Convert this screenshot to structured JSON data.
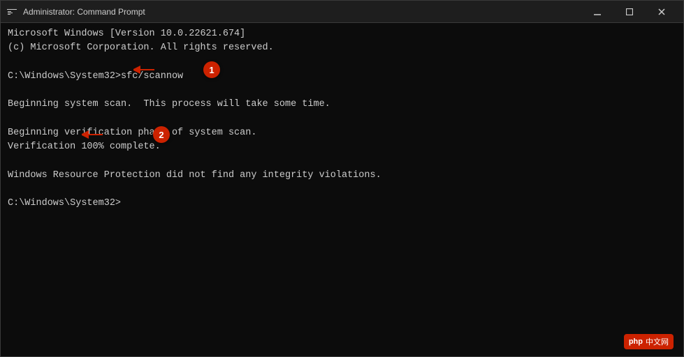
{
  "window": {
    "title": "Administrator: Command Prompt",
    "icon_label": "cmd-icon"
  },
  "titlebar": {
    "minimize_label": "minimize-button",
    "maximize_label": "maximize-button",
    "close_label": "close-button"
  },
  "console": {
    "line1": "Microsoft Windows [Version 10.0.22621.674]",
    "line2": "(c) Microsoft Corporation. All rights reserved.",
    "line3": "",
    "line4": "C:\\Windows\\System32>sfc/scannow",
    "line5": "",
    "line6": "Beginning system scan.  This process will take some time.",
    "line7": "",
    "line8": "Beginning verification phase of system scan.",
    "line9": "Verification 100% complete.",
    "line10": "",
    "line11": "Windows Resource Protection did not find any integrity violations.",
    "line12": "",
    "line13": "C:\\Windows\\System32>"
  },
  "annotations": {
    "badge1": "1",
    "badge2": "2"
  },
  "watermark": {
    "text1": "php",
    "text2": "中文网"
  }
}
